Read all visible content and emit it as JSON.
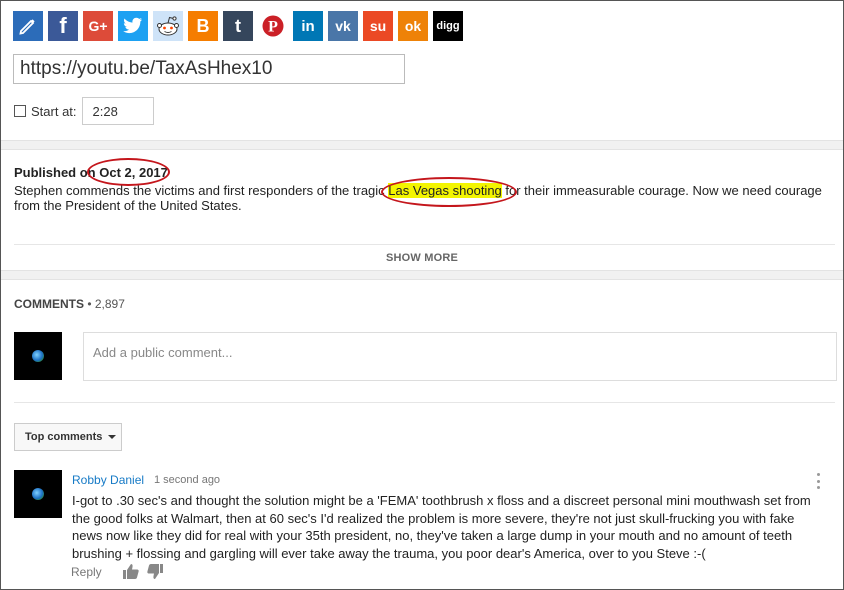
{
  "share": {
    "buttons": [
      {
        "name": "embed",
        "color": "#2c6cb9",
        "icon": "pencil-icon"
      },
      {
        "name": "facebook",
        "color": "#3b5998",
        "icon": "facebook-icon",
        "glyph": "f"
      },
      {
        "name": "google-plus",
        "color": "#dd4b39",
        "icon": "google-plus-icon",
        "glyph": "G+"
      },
      {
        "name": "twitter",
        "color": "#1da1f2",
        "icon": "twitter-icon"
      },
      {
        "name": "reddit",
        "color": "#cee3f8",
        "icon": "reddit-icon"
      },
      {
        "name": "blogger",
        "color": "#f57d00",
        "icon": "blogger-icon",
        "glyph": "B"
      },
      {
        "name": "tumblr",
        "color": "#35465c",
        "icon": "tumblr-icon",
        "glyph": "t"
      },
      {
        "name": "pinterest",
        "color": "#ffffff",
        "icon": "pinterest-icon",
        "glyph": "P"
      },
      {
        "name": "linkedin",
        "color": "#0077b5",
        "icon": "linkedin-icon",
        "glyph": "in"
      },
      {
        "name": "vk",
        "color": "#4a76a8",
        "icon": "vk-icon",
        "glyph": "vk"
      },
      {
        "name": "stumbleupon",
        "color": "#eb4924",
        "icon": "stumbleupon-icon",
        "glyph": "su"
      },
      {
        "name": "odnoklassniki",
        "color": "#ee8208",
        "icon": "odnoklassniki-icon",
        "glyph": "ok"
      },
      {
        "name": "digg",
        "color": "#000000",
        "icon": "digg-icon",
        "glyph": "digg"
      }
    ],
    "url": "https://youtu.be/TaxAsHhex10",
    "start_label": "Start at:",
    "start_value": "2:28"
  },
  "description": {
    "published_prefix": "Published on ",
    "published_date": "Oct 2, 2017",
    "text_before": "Stephen commends the victims and first responders of the tragic ",
    "highlight": "Las Vegas shooting",
    "text_after": " for their immeasurable courage. Now we need courage from the President of the United States.",
    "show_more": "SHOW MORE",
    "annotation_color": "#c4161c",
    "highlight_color": "#f3f500"
  },
  "comments": {
    "label": "COMMENTS",
    "separator": " • ",
    "count": "2,897",
    "placeholder": "Add a public comment...",
    "sort_label": "Top comments",
    "items": [
      {
        "author": "Robby Daniel",
        "time": "1 second ago",
        "text": "I-got to .30 sec's and thought the solution might be a 'FEMA' toothbrush x floss and a discreet personal mini mouthwash set from the good folks at Walmart, then at 60 sec's I'd realized the problem is more severe, they're not just skull-frucking you with fake news now like they did for real with your 35th president, no, they've taken a large dump in your mouth and no amount of teeth brushing + flossing and gargling will ever take away the trauma, you poor dear's America, over to you Steve :-(",
        "reply": "Reply"
      }
    ]
  }
}
